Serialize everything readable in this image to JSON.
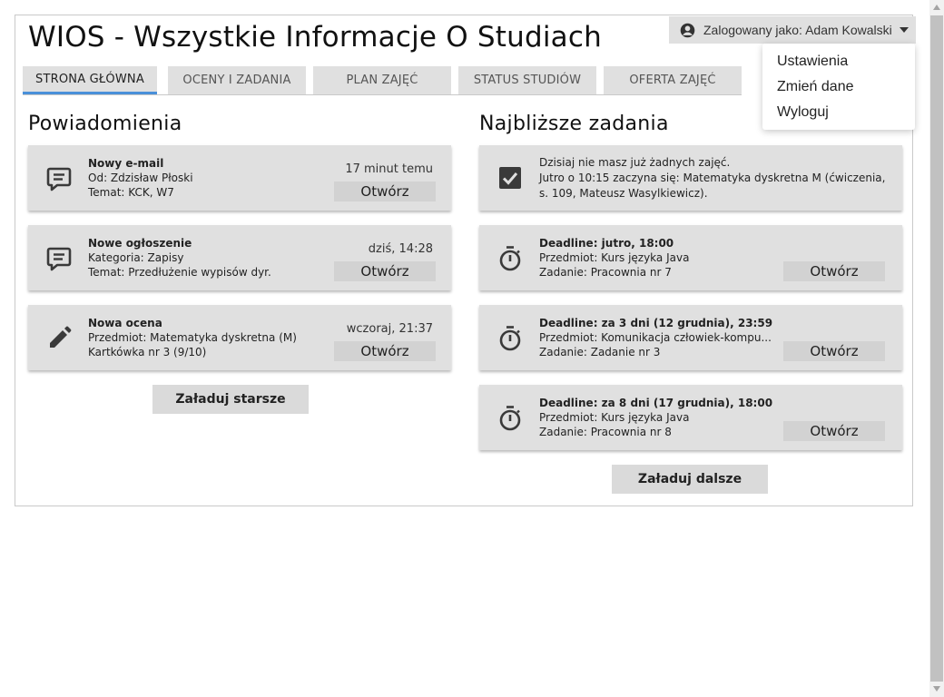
{
  "app": {
    "title": "WIOS - Wszystkie Informacje O Studiach"
  },
  "user": {
    "label": "Zalogowany jako: Adam Kowalski"
  },
  "user_menu": {
    "items": [
      "Ustawienia",
      "Zmień dane",
      "Wyloguj"
    ]
  },
  "tabs": [
    "STRONA GŁÓWNA",
    "OCENY I ZADANIA",
    "PLAN ZAJĘĆ",
    "STATUS STUDIÓW",
    "OFERTA ZAJĘĆ"
  ],
  "notifications": {
    "title": "Powiadomienia",
    "items": [
      {
        "icon": "message-icon",
        "title": "Nowy e-mail",
        "line1": "Od: Zdzisław Płoski",
        "line2": "Temat: KCK, W7",
        "time": "17 minut temu",
        "button": "Otwórz"
      },
      {
        "icon": "message-icon",
        "title": "Nowe ogłoszenie",
        "line1": "Kategoria: Zapisy",
        "line2": "Temat: Przedłużenie wypisów dyr.",
        "time": "dziś, 14:28",
        "button": "Otwórz"
      },
      {
        "icon": "pencil-icon",
        "title": "Nowa ocena",
        "line1": "Przedmiot: Matematyka dyskretna (M)",
        "line2": "Kartkówka nr 3 (9/10)",
        "time": "wczoraj, 21:37",
        "button": "Otwórz"
      }
    ],
    "load_more": "Załaduj starsze"
  },
  "tasks": {
    "title": "Najbliższe zadania",
    "today": {
      "icon": "checkbox-icon",
      "line1": "Dzisiaj nie masz już żadnych zajęć.",
      "line2": "Jutro o 10:15 zaczyna się: Matematyka dyskretna M (ćwiczenia,",
      "line3": "s. 109, Mateusz Wasylkiewicz)."
    },
    "items": [
      {
        "icon": "stopwatch-icon",
        "title": "Deadline: jutro, 18:00",
        "line1": "Przedmiot: Kurs języka Java",
        "line2": "Zadanie: Pracownia nr 7",
        "button": "Otwórz"
      },
      {
        "icon": "stopwatch-icon",
        "title": "Deadline: za 3 dni (12 grudnia), 23:59",
        "line1": "Przedmiot: Komunikacja człowiek-kompu...",
        "line2": "Zadanie: Zadanie nr 3",
        "button": "Otwórz"
      },
      {
        "icon": "stopwatch-icon",
        "title": "Deadline: za 8 dni (17 grudnia), 18:00",
        "line1": "Przedmiot: Kurs języka Java",
        "line2": "Zadanie: Pracownia nr 8",
        "button": "Otwórz"
      }
    ],
    "load_more": "Załaduj dalsze"
  }
}
